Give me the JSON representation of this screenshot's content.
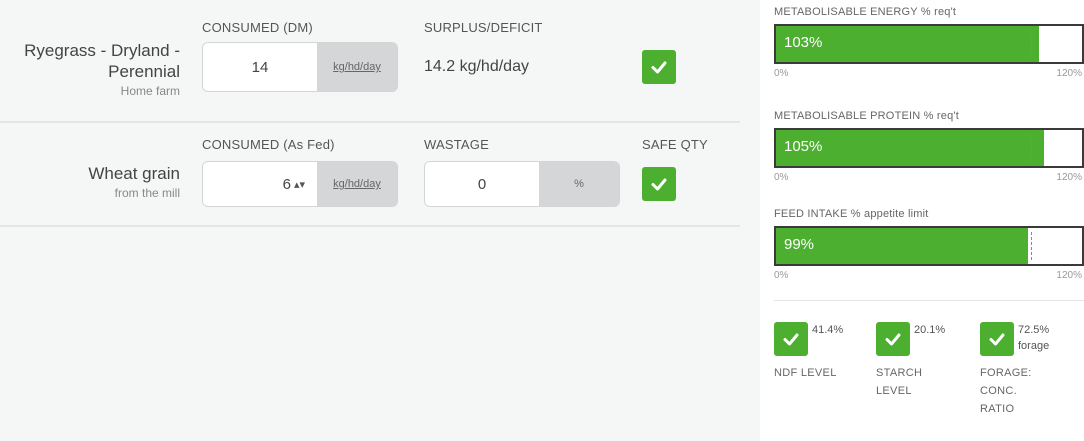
{
  "feeds": [
    {
      "name": "Ryegrass - Dryland - Perennial",
      "source": "Home farm",
      "consumed_label": "CONSUMED (DM)",
      "consumed_value": "14",
      "consumed_unit": "kg/hd/day",
      "second_label": "SURPLUS/DEFICIT",
      "surplus_value": "14.2 kg/hd/day",
      "checked": true
    },
    {
      "name": "Wheat grain",
      "source": "from the mill",
      "consumed_label": "CONSUMED (As Fed)",
      "consumed_value": "6",
      "consumed_unit": "kg/hd/day",
      "second_label": "WASTAGE",
      "wastage_value": "0",
      "wastage_unit": "%",
      "safe_label": "SAFE QTY",
      "checked": true
    }
  ],
  "meters": [
    {
      "label": "METABOLISABLE ENERGY % req't",
      "value_text": "103%",
      "value": 103,
      "min_label": "0%",
      "max_label": "120%",
      "max": 120
    },
    {
      "label": "METABOLISABLE PROTEIN % req't",
      "value_text": "105%",
      "value": 105,
      "min_label": "0%",
      "max_label": "120%",
      "max": 120
    },
    {
      "label": "FEED INTAKE % appetite limit",
      "value_text": "99%",
      "value": 99,
      "min_label": "0%",
      "max_label": "120%",
      "max": 120
    }
  ],
  "indicators": [
    {
      "value": "41.4%",
      "label": "NDF LEVEL"
    },
    {
      "value": "20.1%",
      "label": "STARCH LEVEL"
    },
    {
      "value": "72.5%",
      "value_sub": "forage",
      "label": "FORAGE: CONC. RATIO"
    }
  ],
  "colors": {
    "accent": "#4caf30",
    "meter_border": "#3a3a3a"
  },
  "icons": {
    "check": "check-icon",
    "stepper": "stepper-arrows-icon"
  }
}
